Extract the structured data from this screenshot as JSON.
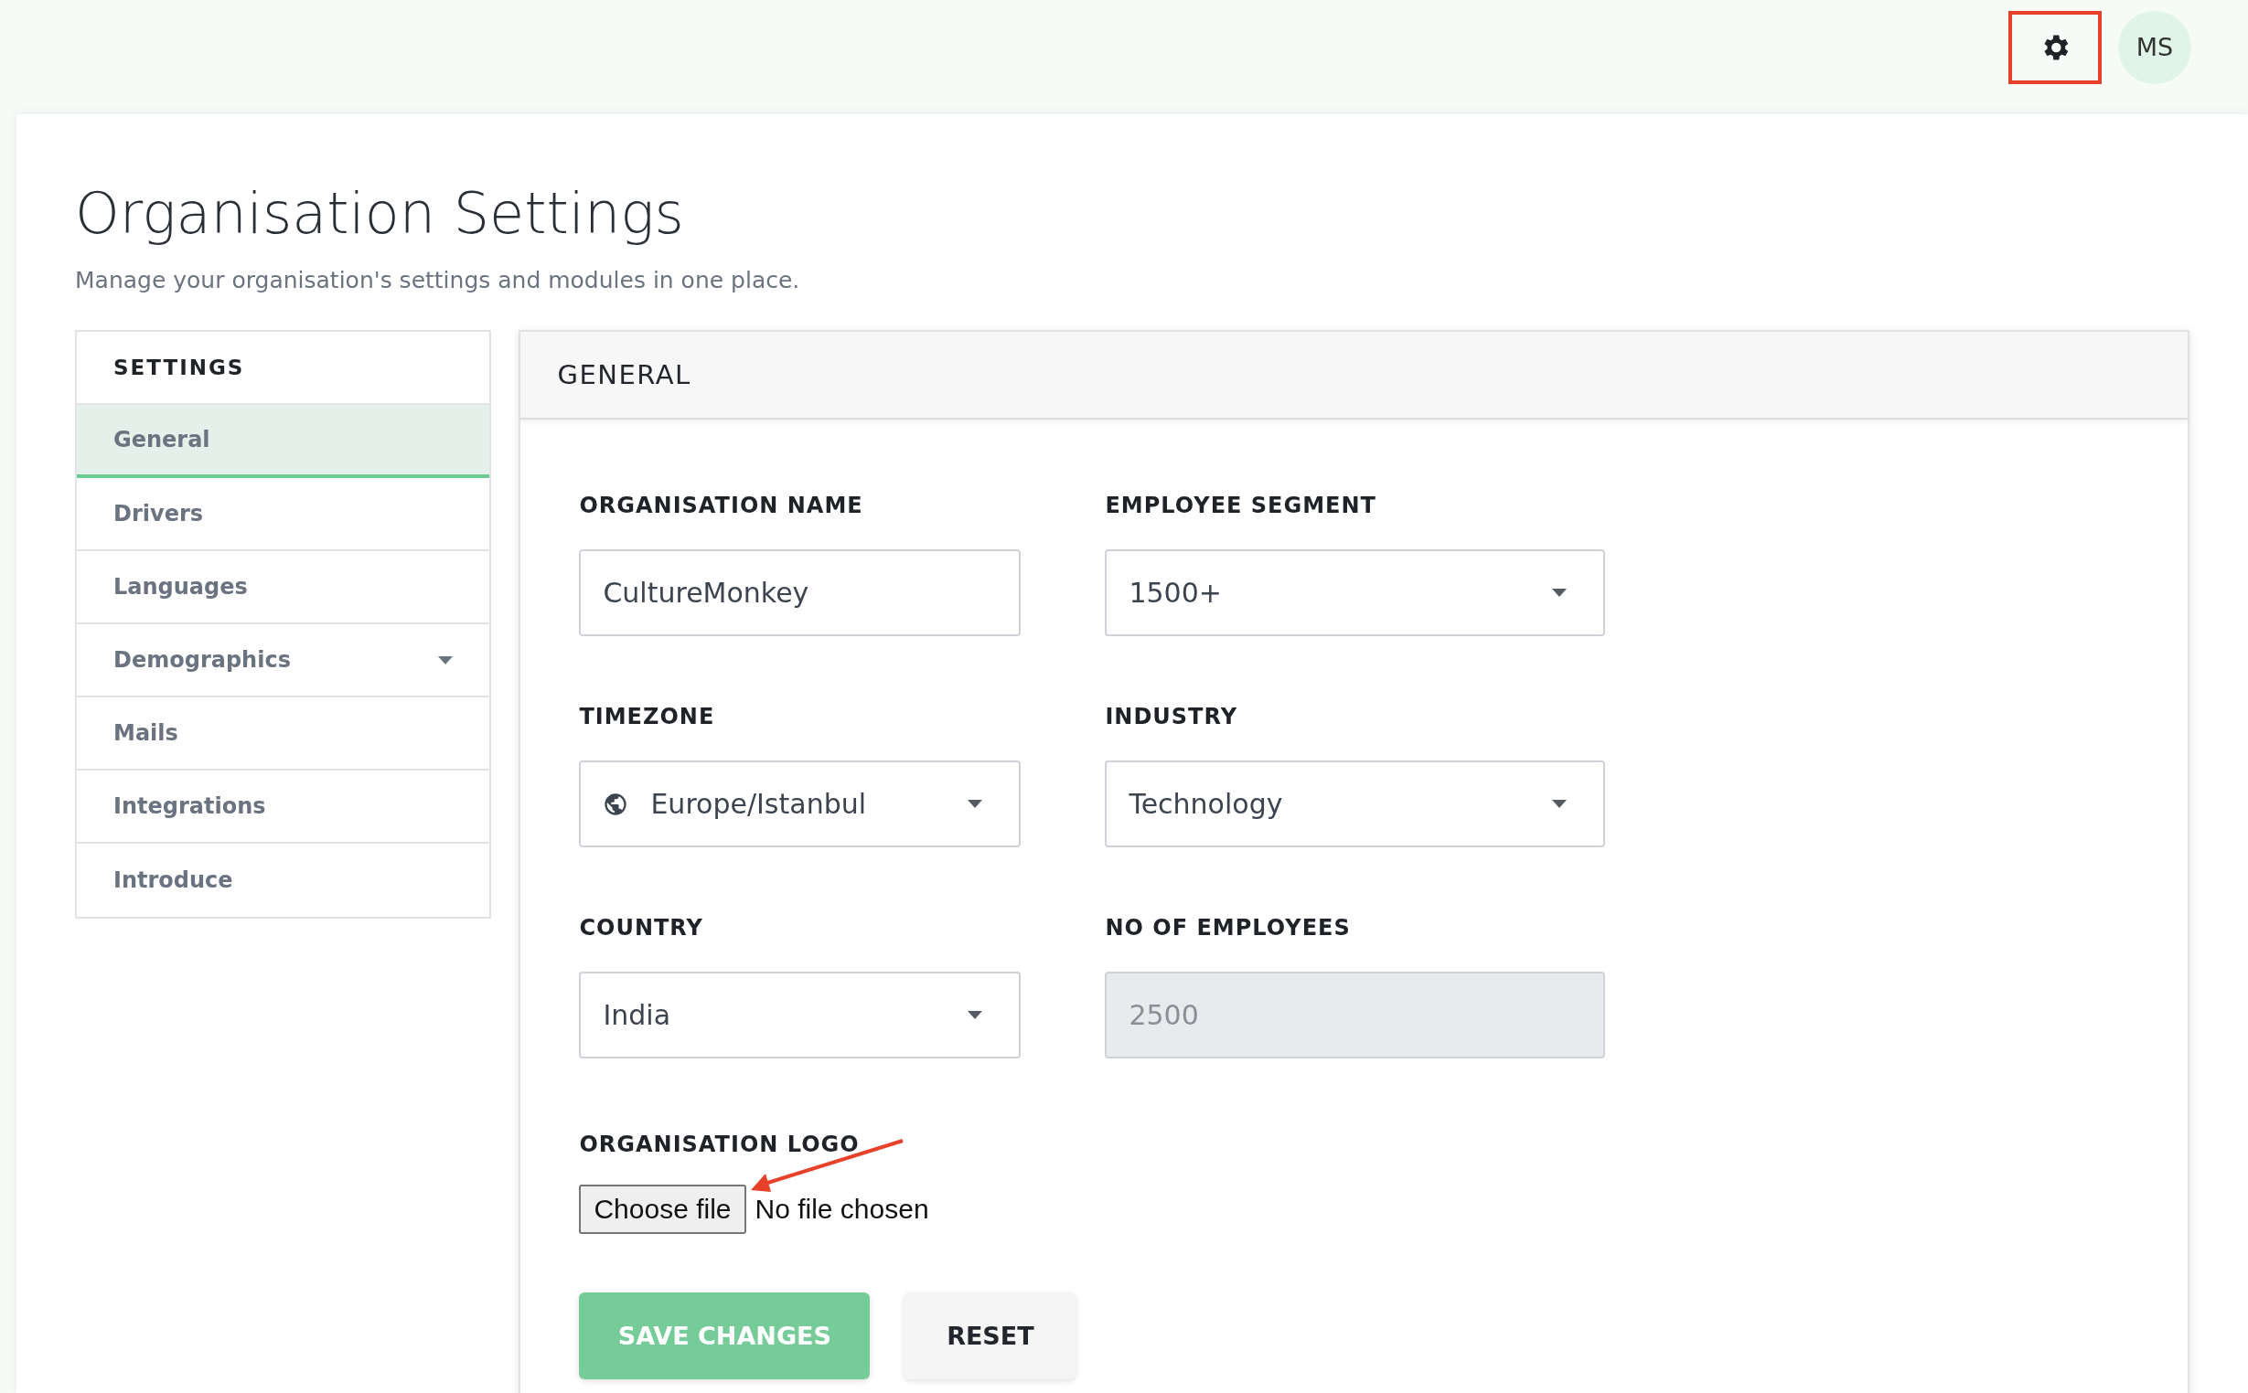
{
  "header": {
    "avatar_initials": "MS"
  },
  "page": {
    "title": "Organisation Settings",
    "subtitle": "Manage your organisation's settings and modules in one place."
  },
  "sidebar": {
    "heading": "SETTINGS",
    "items": [
      {
        "label": "General",
        "selected": true,
        "expandable": false
      },
      {
        "label": "Drivers",
        "selected": false,
        "expandable": false
      },
      {
        "label": "Languages",
        "selected": false,
        "expandable": false
      },
      {
        "label": "Demographics",
        "selected": false,
        "expandable": true
      },
      {
        "label": "Mails",
        "selected": false,
        "expandable": false
      },
      {
        "label": "Integrations",
        "selected": false,
        "expandable": false
      },
      {
        "label": "Introduce",
        "selected": false,
        "expandable": false
      }
    ]
  },
  "panel": {
    "title": "GENERAL",
    "fields": [
      {
        "label": "ORGANISATION NAME",
        "kind": "text",
        "value": "CultureMonkey"
      },
      {
        "label": "EMPLOYEE SEGMENT",
        "kind": "select",
        "value": "1500+"
      },
      {
        "label": "TIMEZONE",
        "kind": "timezone",
        "value": "Europe/Istanbul"
      },
      {
        "label": "INDUSTRY",
        "kind": "select",
        "value": "Technology"
      },
      {
        "label": "COUNTRY",
        "kind": "select",
        "value": "India"
      },
      {
        "label": "NO OF EMPLOYEES",
        "kind": "readonly",
        "value": "2500"
      }
    ],
    "logo": {
      "label": "ORGANISATION LOGO",
      "button": "Choose file",
      "status": "No file chosen"
    },
    "buttons": [
      {
        "label": "SAVE CHANGES",
        "kind": "primary"
      },
      {
        "label": "RESET",
        "kind": "secondary"
      }
    ]
  }
}
